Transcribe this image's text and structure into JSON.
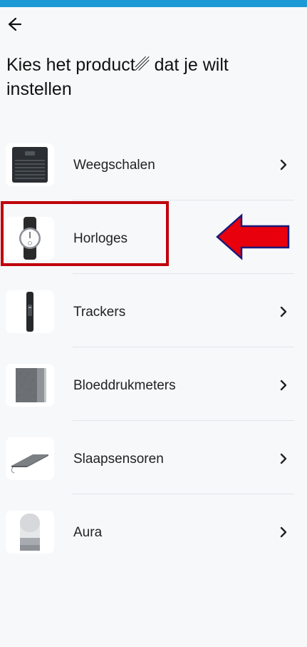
{
  "header": {
    "title": "Kies het product␥ dat je wilt instellen"
  },
  "products": [
    {
      "label": "Weegschalen",
      "icon": "scale-icon",
      "has_chevron": true
    },
    {
      "label": "Horloges",
      "icon": "watch-icon",
      "has_chevron": false
    },
    {
      "label": "Trackers",
      "icon": "tracker-icon",
      "has_chevron": true
    },
    {
      "label": "Bloeddrukmeters",
      "icon": "blood-pressure-icon",
      "has_chevron": true
    },
    {
      "label": "Slaapsensoren",
      "icon": "sleep-sensor-icon",
      "has_chevron": true
    },
    {
      "label": "Aura",
      "icon": "aura-icon",
      "has_chevron": true
    }
  ],
  "colors": {
    "status_bar": "#1c9ad6",
    "highlight": "#c0000a",
    "arrow_fill": "#e8000c",
    "arrow_outline": "#1a1a7a",
    "background": "#f7f8fa"
  }
}
